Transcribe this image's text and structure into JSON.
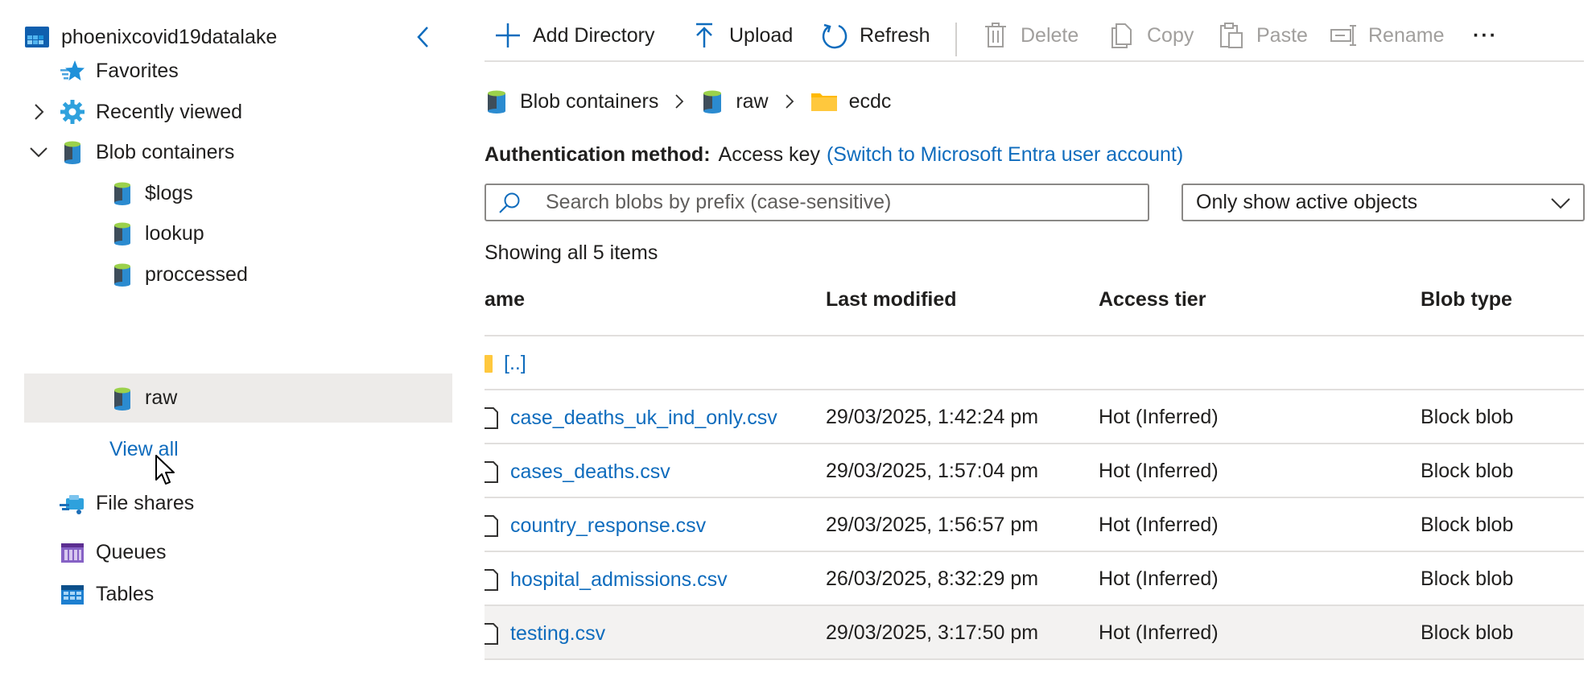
{
  "tree": {
    "account": "phoenixcovid19datalake",
    "favorites": "Favorites",
    "recently_viewed": "Recently viewed",
    "blob_containers": "Blob containers",
    "containers": [
      "$logs",
      "lookup",
      "proccessed",
      "raw"
    ],
    "selected_container": "raw",
    "view_all": "View all",
    "file_shares": "File shares",
    "queues": "Queues",
    "tables": "Tables"
  },
  "toolbar": {
    "add_directory": "Add Directory",
    "upload": "Upload",
    "refresh": "Refresh",
    "delete": "Delete",
    "copy": "Copy",
    "paste": "Paste",
    "rename": "Rename",
    "more": "···"
  },
  "breadcrumb": [
    "Blob containers",
    "raw",
    "ecdc"
  ],
  "auth": {
    "label": "Authentication method:",
    "value": "Access key",
    "switch_link": "(Switch to Microsoft Entra user account)"
  },
  "search": {
    "placeholder": "Search blobs by prefix (case-sensitive)",
    "value": ""
  },
  "filter": {
    "selected": "Only show active objects"
  },
  "item_count": "Showing all 5 items",
  "table": {
    "columns": [
      "ame",
      "Last modified",
      "Access tier",
      "Blob type"
    ],
    "parent_row": "[..]",
    "rows": [
      {
        "name": "case_deaths_uk_ind_only.csv",
        "modified": "29/03/2025, 1:42:24 pm",
        "tier": "Hot (Inferred)",
        "type": "Block blob"
      },
      {
        "name": "cases_deaths.csv",
        "modified": "29/03/2025, 1:57:04 pm",
        "tier": "Hot (Inferred)",
        "type": "Block blob"
      },
      {
        "name": "country_response.csv",
        "modified": "29/03/2025, 1:56:57 pm",
        "tier": "Hot (Inferred)",
        "type": "Block blob"
      },
      {
        "name": "hospital_admissions.csv",
        "modified": "26/03/2025, 8:32:29 pm",
        "tier": "Hot (Inferred)",
        "type": "Block blob"
      },
      {
        "name": "testing.csv",
        "modified": "29/03/2025, 3:17:50 pm",
        "tier": "Hot (Inferred)",
        "type": "Block blob"
      }
    ]
  },
  "colors": {
    "link": "#0f6cbd",
    "selected_bg": "#edebe9",
    "disabled": "#a19f9d",
    "border": "#8a8886"
  }
}
